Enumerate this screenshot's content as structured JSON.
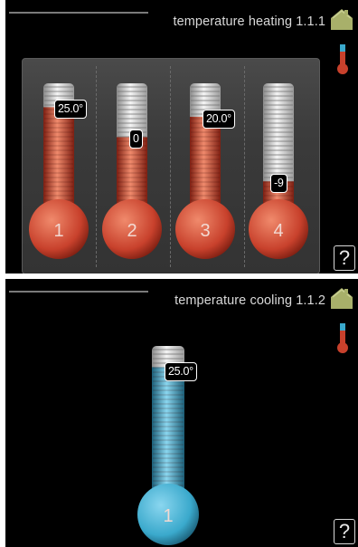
{
  "heating": {
    "title": "temperature heating 1.1.1",
    "help": "?",
    "thermometers": [
      {
        "number": "1",
        "label": "25.0°",
        "level": 0.8
      },
      {
        "number": "2",
        "label": "0",
        "level": 0.55
      },
      {
        "number": "3",
        "label": "20.0°",
        "level": 0.72
      },
      {
        "number": "4",
        "label": "-9",
        "level": 0.18
      }
    ]
  },
  "cooling": {
    "title": "temperature cooling 1.1.2",
    "help": "?",
    "thermometer": {
      "number": "1",
      "label": "25.0°",
      "level": 0.85
    }
  },
  "colors": {
    "heating_red": "#c8412c",
    "cooling_blue": "#3aa9cc",
    "background": "#000000",
    "home_green": "#a8b06a"
  },
  "icons": [
    "home-icon",
    "mini-thermometer-icon",
    "help-icon"
  ]
}
